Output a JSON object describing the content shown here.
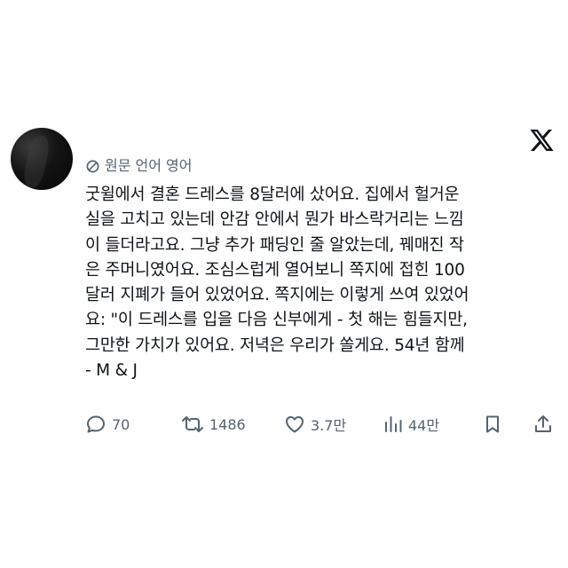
{
  "post": {
    "translation_label": "원문 언어 영어",
    "text_lines": [
      "굿윌에서 결혼 드레스를 8달러에 샀어요. 집에서 헐거운",
      "실을 고치고 있는데 안감 안에서 뭔가 바스락거리는 느낌",
      "이 들더라고요. 그냥 추가 패딩인 줄 알았는데, 꿰매진 작",
      "은 주머니였어요. 조심스럽게 열어보니 쪽지에 접힌 100",
      "달러 지폐가 들어 있었어요. 쪽지에는 이렇게 쓰여 있었어",
      "요: \"이 드레스를 입을 다음 신부에게 - 첫 해는 힘들지만,",
      "그만한 가치가 있어요. 저녁은 우리가 쏠게요. 54년 함께",
      "- M & J"
    ]
  },
  "actions": {
    "replies": "70",
    "reposts": "1486",
    "likes": "3.7만",
    "views": "44만"
  },
  "icons": {
    "brand": "x-logo-icon",
    "translate": "translate-icon",
    "reply": "reply-icon",
    "repost": "repost-icon",
    "like": "heart-icon",
    "views": "views-chart-icon",
    "bookmark": "bookmark-icon",
    "share": "share-icon"
  },
  "colors": {
    "text": "#0f1419",
    "secondary": "#536471",
    "background": "#ffffff"
  }
}
